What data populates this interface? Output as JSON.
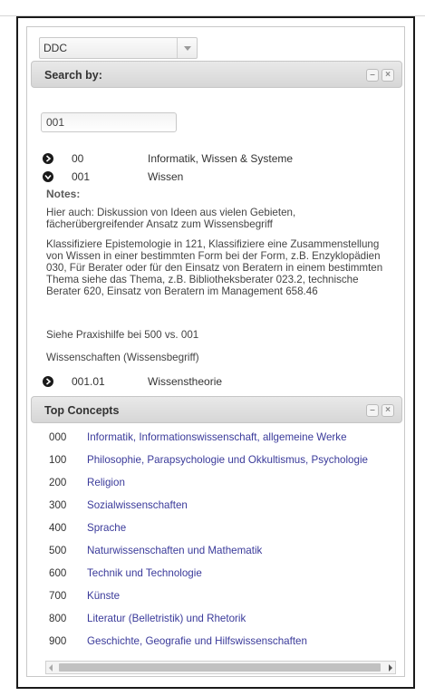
{
  "scheme_select": {
    "value": "DDC"
  },
  "search_panel": {
    "title": "Search by:",
    "minimize": "–",
    "close": "×"
  },
  "search": {
    "value": "001"
  },
  "tree": [
    {
      "code": "00",
      "label": "Informatik, Wissen & Systeme",
      "state": "collapsed"
    },
    {
      "code": "001",
      "label": "Wissen",
      "state": "expanded"
    }
  ],
  "notes": {
    "title": "Notes:",
    "paragraphs": [
      "Hier auch: Diskussion von Ideen aus vielen Gebieten, fächerübergreifender Ansatz zum Wissensbegriff",
      "Klassifiziere Epistemologie in 121, Klassifiziere eine Zusammenstellung von Wissen in einer bestimmten Form bei der Form, z.B. Enzyklopädien 030, Für Berater oder für den Einsatz von Beratern in einem bestimmten Thema siehe das Thema, z.B. Bibliotheksberater 023.2, technische Berater 620, Einsatz von Beratern im Management 658.46",
      "Siehe Praxishilfe bei 500 vs. 001",
      "Wissenschaften (Wissensbegriff)"
    ]
  },
  "child": {
    "code": "001.01",
    "label": "Wissenstheorie"
  },
  "top_panel": {
    "title": "Top Concepts",
    "minimize": "–",
    "close": "×"
  },
  "top_concepts": [
    {
      "code": "000",
      "label": "Informatik, Informationswissenschaft, allgemeine Werke"
    },
    {
      "code": "100",
      "label": "Philosophie, Parapsychologie und Okkultismus, Psychologie"
    },
    {
      "code": "200",
      "label": "Religion"
    },
    {
      "code": "300",
      "label": "Sozialwissenschaften"
    },
    {
      "code": "400",
      "label": "Sprache"
    },
    {
      "code": "500",
      "label": "Naturwissenschaften und Mathematik"
    },
    {
      "code": "600",
      "label": "Technik und Technologie"
    },
    {
      "code": "700",
      "label": "Künste"
    },
    {
      "code": "800",
      "label": "Literatur (Belletristik) und Rhetorik"
    },
    {
      "code": "900",
      "label": "Geschichte, Geografie und Hilfswissenschaften"
    }
  ],
  "colors": {
    "link": "#3a3a9a",
    "panel_header": "#dddddd",
    "frame": "#1a1a1a"
  }
}
